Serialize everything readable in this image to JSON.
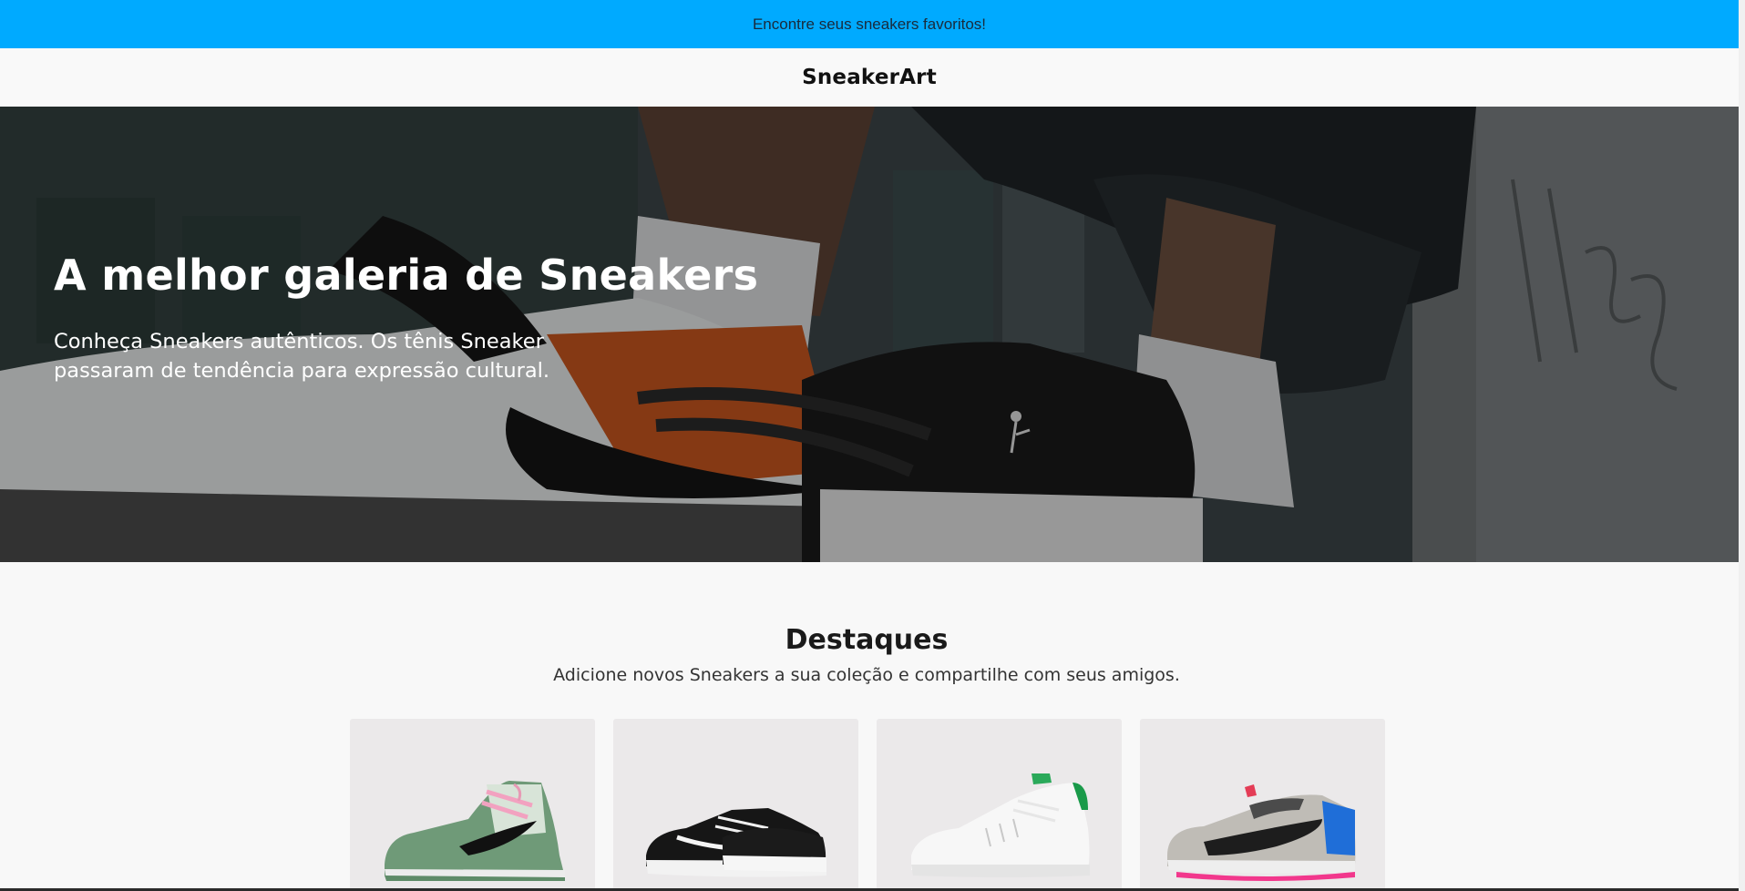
{
  "promo": {
    "text": "Encontre seus sneakers favoritos!"
  },
  "header": {
    "brand": "SneakerArt"
  },
  "hero": {
    "title": "A melhor galeria de Sneakers",
    "subtitle": "Conheça Sneakers autênticos. Os tênis Sneaker passaram de tendência para expressão cultural."
  },
  "highlights": {
    "title": "Destaques",
    "subtitle": "Adicione novos Sneakers a sua coleção e compartilhe com seus amigos.",
    "cards": [
      {
        "product": "green-high-top-sneaker"
      },
      {
        "product": "black-low-top-sneaker"
      },
      {
        "product": "white-green-sneaker"
      },
      {
        "product": "grey-runner-sneaker"
      }
    ]
  },
  "colors": {
    "promo_bg": "#00aaff",
    "header_bg": "#f9f9f9",
    "card_bg": "#ebe9ea"
  }
}
